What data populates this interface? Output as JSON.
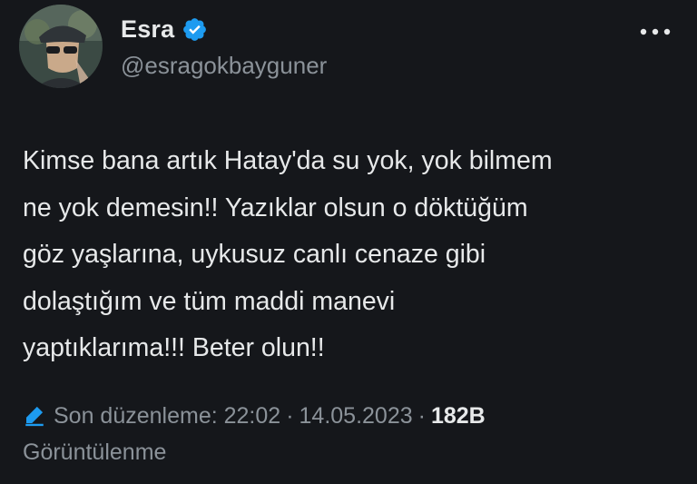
{
  "user": {
    "display_name": "Esra",
    "handle": "@esragokbayguner",
    "verified_icon": "verified-badge-icon",
    "accent": "#1d9bf0"
  },
  "tweet": {
    "text": "Kimse bana artık Hatay'da su yok, yok bilmem\nne yok demesin!! Yazıklar olsun o döktüğüm\ngöz yaşlarına, uykusuz canlı cenaze gibi\ndolaştığım ve tüm maddi manevi\nyaptıklarıma!!! Beter olun!!"
  },
  "meta": {
    "edited_label": "Son düzenleme: 22:02",
    "separator": "·",
    "date": "14.05.2023",
    "views_count": "182B",
    "views_label": "Görüntülenme"
  },
  "colors": {
    "background": "#15171b",
    "text": "#e7e9ea",
    "muted": "#8b9299"
  }
}
